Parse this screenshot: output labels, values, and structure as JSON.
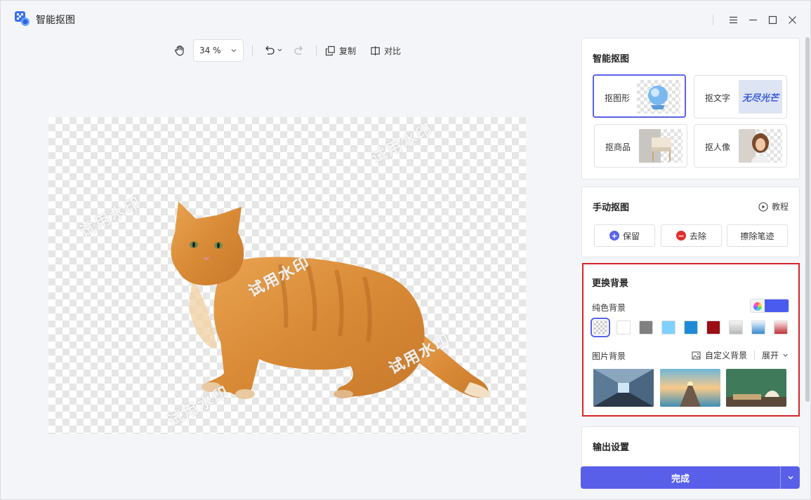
{
  "app": {
    "title": "智能抠图"
  },
  "toolbar": {
    "zoom": "34 %",
    "copy_label": "复制",
    "compare_label": "对比"
  },
  "canvas": {
    "watermark_text": "试用水印"
  },
  "smart_cutout": {
    "title": "智能抠图",
    "modes": [
      {
        "label": "抠图形",
        "active": true
      },
      {
        "label": "抠文字",
        "thumb_text": "无尽光芒"
      },
      {
        "label": "抠商品"
      },
      {
        "label": "抠人像"
      }
    ]
  },
  "manual_cutout": {
    "title": "手动抠图",
    "tutorial_label": "教程",
    "buttons": {
      "keep": "保留",
      "remove": "去除",
      "erase": "擦除笔迹"
    }
  },
  "change_bg": {
    "title": "更换背景",
    "solid_label": "纯色背景",
    "accent_color": "#4a5cf0",
    "swatches": [
      "transparent",
      "#ffffff",
      "#808080",
      "#7fd0ff",
      "#1e8bd6",
      "#9b0e14",
      "gradient-gray",
      "gradient-blue",
      "gradient-red"
    ],
    "image_label": "图片背景",
    "custom_label": "自定义背景",
    "expand_label": "展开"
  },
  "output": {
    "title": "输出设置"
  },
  "done": {
    "label": "完成"
  }
}
